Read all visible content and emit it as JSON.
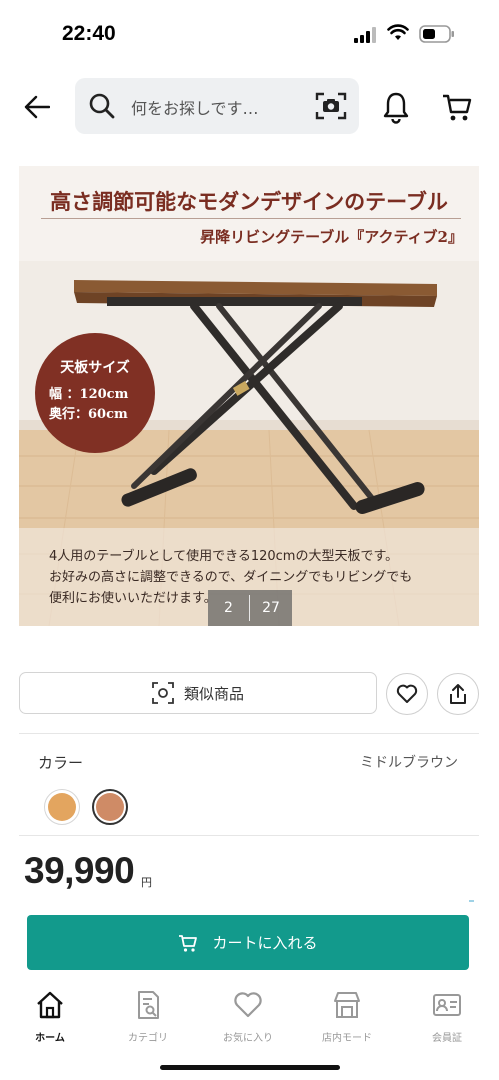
{
  "status_bar": {
    "time": "22:40"
  },
  "header": {
    "search_placeholder": "何をお探しです…"
  },
  "product_image": {
    "headline": "高さ調節可能なモダンデザインのテーブル",
    "subheadline": "昇降リビングテーブル『アクティブ2』",
    "size_badge": {
      "title": "天板サイズ",
      "width": "幅 ：120cm",
      "depth": "奥行：60cm"
    },
    "caption": [
      "4人用のテーブルとして使用できる120cmの大型天板です。",
      "お好みの高さに調整できるので、ダイニングでもリビングでも",
      "便利にお使いいただけます。"
    ],
    "counter": {
      "current": "2",
      "total": "27"
    }
  },
  "actions": {
    "similar_label": "類似商品"
  },
  "color": {
    "label": "カラー",
    "selected_value": "ミドルブラウン",
    "swatches": [
      {
        "name": "light",
        "hex": "#e3a55f",
        "selected": false
      },
      {
        "name": "middle-brown",
        "hex": "#cf8b66",
        "selected": true
      }
    ]
  },
  "price": {
    "amount": "39,990",
    "unit": "円"
  },
  "cart": {
    "label": "カートに入れる",
    "accent": "#129a8c"
  },
  "bottom_nav": {
    "items": [
      {
        "label": "ホーム",
        "icon": "home-icon",
        "active": true
      },
      {
        "label": "カテゴリ",
        "icon": "category-icon",
        "active": false
      },
      {
        "label": "お気に入り",
        "icon": "heart-icon",
        "active": false
      },
      {
        "label": "店内モード",
        "icon": "store-icon",
        "active": false
      },
      {
        "label": "会員証",
        "icon": "member-card-icon",
        "active": false
      }
    ]
  }
}
